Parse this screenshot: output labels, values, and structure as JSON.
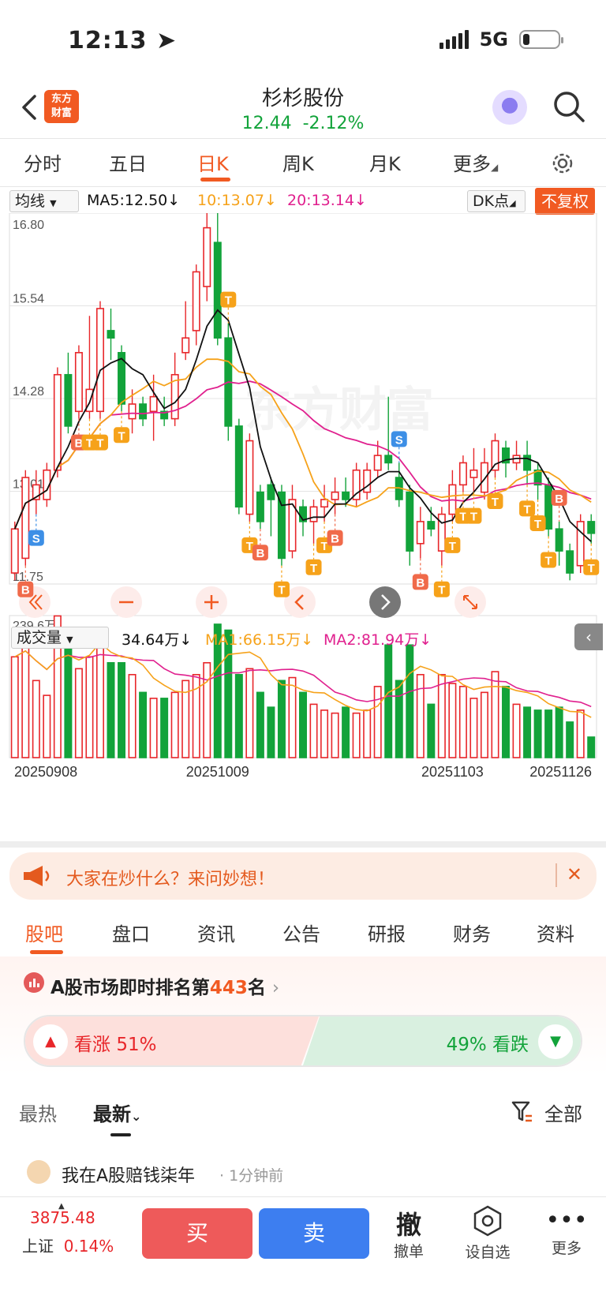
{
  "status": {
    "time": "12:13",
    "network": "5G"
  },
  "header": {
    "logo_line1": "东方",
    "logo_line2": "财富",
    "title": "杉杉股份",
    "price": "12.44",
    "change": "-2.12%"
  },
  "chart_tabs": [
    "分时",
    "五日",
    "日K",
    "周K",
    "月K",
    "更多"
  ],
  "active_tab": "日K",
  "indicator": {
    "selector": "均线",
    "ma5": "MA5:12.50",
    "ma10": "10:13.07",
    "ma20": "20:13.14",
    "dk": "DK点",
    "fuquan": "不复权"
  },
  "price_axis": [
    "16.80",
    "15.54",
    "14.28",
    "13.01",
    "11.75"
  ],
  "volume": {
    "selector": "成交量",
    "value": "34.64万",
    "ma1": "MA1:66.15万",
    "ma2": "MA2:81.94万",
    "axis_top": "239.6万"
  },
  "dates": [
    "20250908",
    "20251009",
    "20251103",
    "20251126"
  ],
  "banner": {
    "text": "大家在炒什么？来问妙想！"
  },
  "info_tabs": [
    "股吧",
    "盘口",
    "资讯",
    "公告",
    "研报",
    "财务",
    "资料"
  ],
  "rank": {
    "prefix": "A股市场即时排名第",
    "number": "443",
    "suffix": "名"
  },
  "vote": {
    "up_label": "看涨",
    "up_pct": "51%",
    "down_pct": "49%",
    "down_label": "看跌"
  },
  "feed": {
    "tab_hot": "最热",
    "tab_new": "最新",
    "filter": "全部"
  },
  "post": {
    "author": "我在A股赔钱柒年",
    "time": "1分钟前"
  },
  "bottom": {
    "index_value": "3875.48",
    "index_name": "上证",
    "index_change": "0.14%",
    "buy": "买",
    "sell": "卖",
    "cancel_glyph": "撤",
    "cancel_label": "撤单",
    "watch_label": "设自选",
    "more_label": "更多"
  },
  "colors": {
    "up": "#e8262a",
    "down": "#12a33a",
    "accent": "#f15a22",
    "ma5": "#111111",
    "ma10": "#f6a21a",
    "ma20": "#e0208e"
  },
  "chart_data": {
    "type": "candlestick",
    "price_ylim": [
      11.75,
      16.8
    ],
    "volume_ylim": [
      0,
      239.6
    ],
    "x_ticks": [
      "20250908",
      "20251009",
      "20251103",
      "20251126"
    ],
    "candles": [
      {
        "o": 11.9,
        "c": 12.5,
        "h": 12.6,
        "l": 11.8,
        "v": 170
      },
      {
        "o": 12.1,
        "c": 13.2,
        "h": 13.3,
        "l": 12.0,
        "v": 190
      },
      {
        "o": 12.9,
        "c": 13.1,
        "h": 13.3,
        "l": 12.7,
        "v": 130
      },
      {
        "o": 12.9,
        "c": 13.3,
        "h": 13.4,
        "l": 12.8,
        "v": 105
      },
      {
        "o": 13.3,
        "c": 14.6,
        "h": 14.7,
        "l": 13.2,
        "v": 239
      },
      {
        "o": 14.6,
        "c": 13.9,
        "h": 14.9,
        "l": 13.8,
        "v": 200
      },
      {
        "o": 14.1,
        "c": 14.9,
        "h": 15.0,
        "l": 14.0,
        "v": 150
      },
      {
        "o": 14.1,
        "c": 14.4,
        "h": 15.4,
        "l": 14.0,
        "v": 170
      },
      {
        "o": 14.1,
        "c": 15.5,
        "h": 15.6,
        "l": 14.0,
        "v": 210
      },
      {
        "o": 15.2,
        "c": 15.1,
        "h": 15.5,
        "l": 14.8,
        "v": 160
      },
      {
        "o": 14.9,
        "c": 14.2,
        "h": 15.0,
        "l": 14.1,
        "v": 160
      },
      {
        "o": 14.0,
        "c": 14.2,
        "h": 14.4,
        "l": 13.8,
        "v": 140
      },
      {
        "o": 14.2,
        "c": 14.0,
        "h": 14.3,
        "l": 13.9,
        "v": 110
      },
      {
        "o": 14.1,
        "c": 14.3,
        "h": 14.6,
        "l": 13.7,
        "v": 100
      },
      {
        "o": 14.1,
        "c": 14.0,
        "h": 14.3,
        "l": 13.9,
        "v": 100
      },
      {
        "o": 14.0,
        "c": 14.6,
        "h": 14.9,
        "l": 13.9,
        "v": 110
      },
      {
        "o": 14.9,
        "c": 15.1,
        "h": 15.6,
        "l": 14.8,
        "v": 130
      },
      {
        "o": 15.2,
        "c": 16.0,
        "h": 16.1,
        "l": 15.0,
        "v": 140
      },
      {
        "o": 15.8,
        "c": 16.6,
        "h": 16.8,
        "l": 15.6,
        "v": 160
      },
      {
        "o": 16.4,
        "c": 15.1,
        "h": 16.8,
        "l": 15.0,
        "v": 225
      },
      {
        "o": 15.1,
        "c": 13.9,
        "h": 15.3,
        "l": 13.7,
        "v": 215
      },
      {
        "o": 13.9,
        "c": 12.8,
        "h": 14.0,
        "l": 12.7,
        "v": 140
      },
      {
        "o": 12.7,
        "c": 13.7,
        "h": 13.8,
        "l": 12.6,
        "v": 150
      },
      {
        "o": 13.0,
        "c": 12.6,
        "h": 13.1,
        "l": 12.5,
        "v": 110
      },
      {
        "o": 13.1,
        "c": 12.9,
        "h": 13.2,
        "l": 12.4,
        "v": 85
      },
      {
        "o": 13.0,
        "c": 12.1,
        "h": 13.1,
        "l": 12.0,
        "v": 130
      },
      {
        "o": 12.2,
        "c": 12.9,
        "h": 13.1,
        "l": 12.1,
        "v": 135
      },
      {
        "o": 12.8,
        "c": 12.6,
        "h": 12.9,
        "l": 12.4,
        "v": 110
      },
      {
        "o": 12.6,
        "c": 12.8,
        "h": 12.9,
        "l": 12.3,
        "v": 90
      },
      {
        "o": 12.8,
        "c": 12.9,
        "h": 13.1,
        "l": 12.6,
        "v": 80
      },
      {
        "o": 12.9,
        "c": 13.0,
        "h": 13.2,
        "l": 12.7,
        "v": 75
      },
      {
        "o": 13.0,
        "c": 12.9,
        "h": 13.2,
        "l": 12.8,
        "v": 85
      },
      {
        "o": 12.9,
        "c": 13.3,
        "h": 13.4,
        "l": 12.8,
        "v": 75
      },
      {
        "o": 13.0,
        "c": 13.3,
        "h": 13.4,
        "l": 12.9,
        "v": 80
      },
      {
        "o": 13.3,
        "c": 13.5,
        "h": 13.7,
        "l": 13.2,
        "v": 120
      },
      {
        "o": 13.5,
        "c": 13.4,
        "h": 14.3,
        "l": 13.3,
        "v": 190
      },
      {
        "o": 13.2,
        "c": 12.9,
        "h": 13.4,
        "l": 12.8,
        "v": 130
      },
      {
        "o": 13.0,
        "c": 12.2,
        "h": 13.1,
        "l": 12.0,
        "v": 190
      },
      {
        "o": 12.3,
        "c": 12.6,
        "h": 12.8,
        "l": 12.1,
        "v": 140
      },
      {
        "o": 12.6,
        "c": 12.5,
        "h": 12.8,
        "l": 12.4,
        "v": 90
      },
      {
        "o": 12.2,
        "c": 12.7,
        "h": 12.8,
        "l": 12.0,
        "v": 140
      },
      {
        "o": 12.7,
        "c": 13.1,
        "h": 13.3,
        "l": 12.6,
        "v": 125
      },
      {
        "o": 13.1,
        "c": 13.4,
        "h": 13.5,
        "l": 13.0,
        "v": 120
      },
      {
        "o": 13.2,
        "c": 13.3,
        "h": 13.6,
        "l": 13.0,
        "v": 100
      },
      {
        "o": 13.0,
        "c": 13.4,
        "h": 13.6,
        "l": 12.9,
        "v": 110
      },
      {
        "o": 13.3,
        "c": 13.7,
        "h": 13.8,
        "l": 13.2,
        "v": 145
      },
      {
        "o": 13.6,
        "c": 13.4,
        "h": 13.7,
        "l": 13.2,
        "v": 120
      },
      {
        "o": 13.4,
        "c": 13.5,
        "h": 13.7,
        "l": 13.3,
        "v": 90
      },
      {
        "o": 13.5,
        "c": 13.3,
        "h": 13.7,
        "l": 13.1,
        "v": 85
      },
      {
        "o": 13.3,
        "c": 13.1,
        "h": 13.4,
        "l": 12.9,
        "v": 80
      },
      {
        "o": 13.1,
        "c": 12.5,
        "h": 13.2,
        "l": 12.4,
        "v": 80
      },
      {
        "o": 12.5,
        "c": 12.2,
        "h": 12.6,
        "l": 12.0,
        "v": 85
      },
      {
        "o": 12.2,
        "c": 11.9,
        "h": 12.3,
        "l": 11.8,
        "v": 60
      },
      {
        "o": 12.0,
        "c": 12.6,
        "h": 12.7,
        "l": 11.9,
        "v": 80
      },
      {
        "o": 12.6,
        "c": 12.44,
        "h": 12.7,
        "l": 12.3,
        "v": 34.64
      }
    ]
  }
}
